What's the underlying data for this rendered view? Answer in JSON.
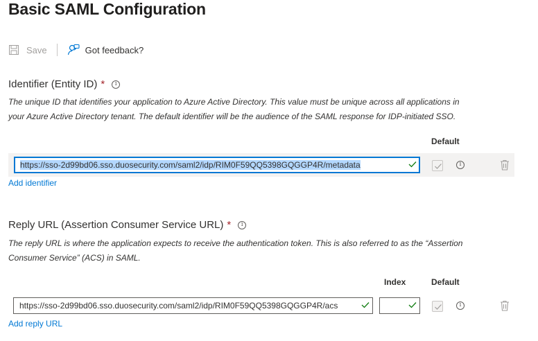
{
  "header": {
    "title": "Basic SAML Configuration"
  },
  "toolbar": {
    "save_label": "Save",
    "feedback_label": "Got feedback?"
  },
  "identifier": {
    "label": "Identifier (Entity ID)",
    "required_mark": "*",
    "description_line1": "The unique ID that identifies your application to Azure Active Directory. This value must be unique across all applications in",
    "description_line2": "your Azure Active Directory tenant. The default identifier will be the audience of the SAML response for IDP-initiated SSO.",
    "default_header": "Default",
    "value": "https://sso-2d99bd06.sso.duosecurity.com/saml2/idp/RIM0F59QQ5398GQGGP4R/metadata",
    "add_link": "Add identifier"
  },
  "reply_url": {
    "label": "Reply URL (Assertion Consumer Service URL)",
    "required_mark": "*",
    "description_line1": "The reply URL is where the application expects to receive the authentication token. This is also referred to as the “Assertion",
    "description_line2": "Consumer Service” (ACS) in SAML.",
    "index_header": "Index",
    "default_header": "Default",
    "value": "https://sso-2d99bd06.sso.duosecurity.com/saml2/idp/RIM0F59QQ5398GQGGP4R/acs",
    "index_value": "",
    "add_link": "Add reply URL"
  },
  "colors": {
    "accent": "#0078d4",
    "required": "#a4262c",
    "valid": "#107c10"
  }
}
